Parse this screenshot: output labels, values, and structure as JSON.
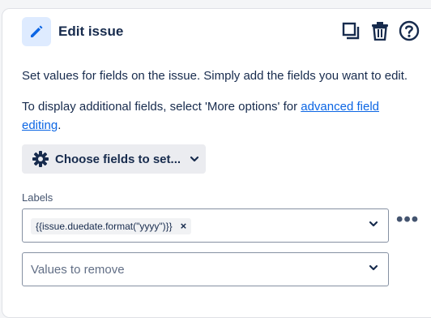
{
  "header": {
    "title": "Edit issue",
    "icons": [
      "pencil-icon",
      "copy-icon",
      "trash-icon",
      "help-icon"
    ]
  },
  "description": {
    "line1": "Set values for fields on the issue. Simply add the fields you want to edit.",
    "line2_prefix": "To display additional fields, select 'More options' for ",
    "line2_link": "advanced field editing",
    "line2_suffix": "."
  },
  "choose_fields": {
    "label": "Choose fields to set..."
  },
  "labels_field": {
    "label": "Labels",
    "tag": "{{issue.duedate.format(\"yyyy\")}}",
    "remove_placeholder": "Values to remove",
    "more_label": "•••"
  },
  "colors": {
    "accent": "#0c66e4",
    "badge_bg": "#deebff",
    "button_bg": "#ebecf0"
  }
}
